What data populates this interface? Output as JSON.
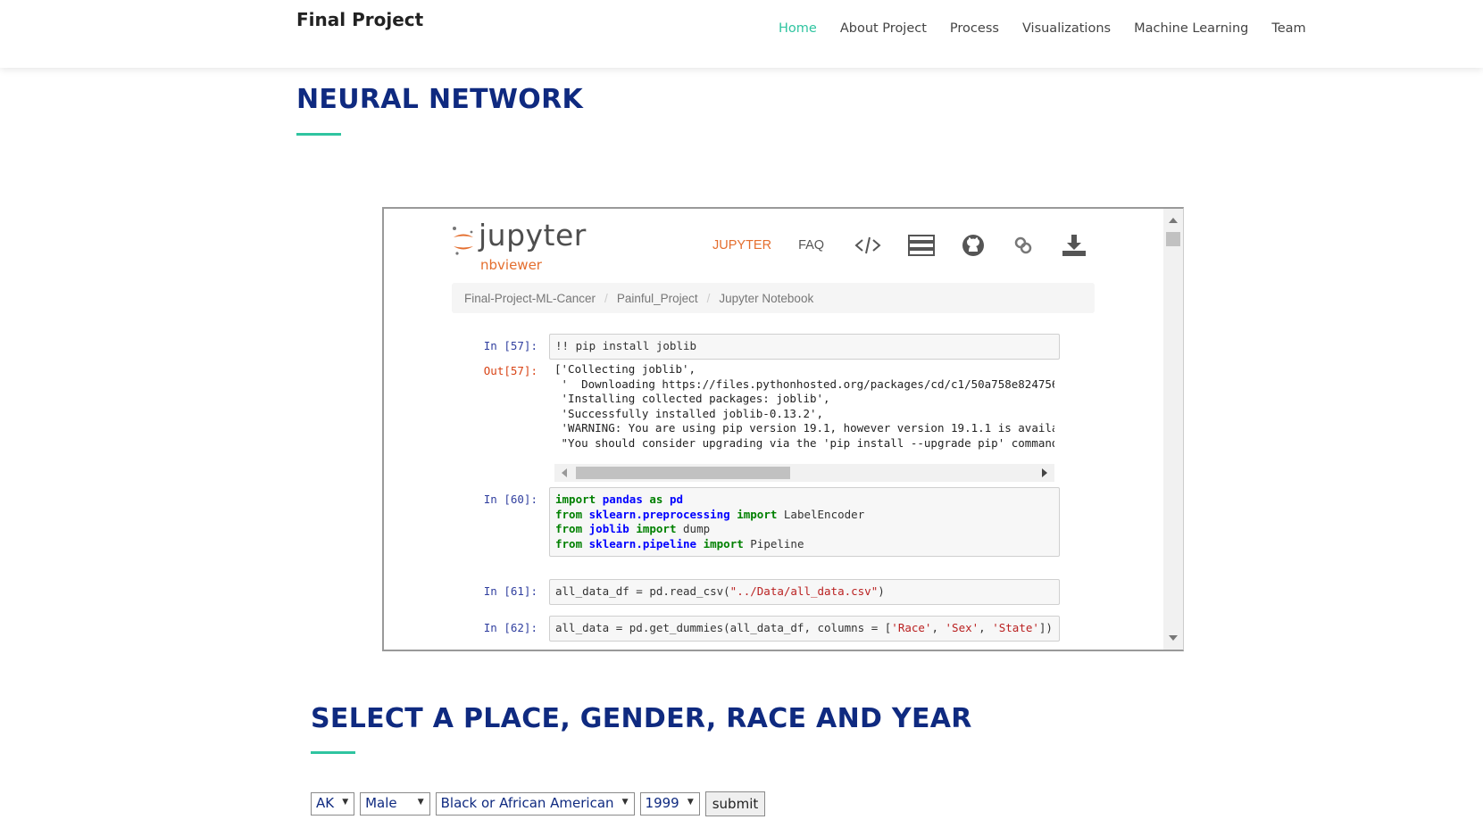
{
  "header": {
    "brand": "Final Project",
    "nav": [
      "Home",
      "About Project",
      "Process",
      "Visualizations",
      "Machine Learning",
      "Team"
    ],
    "active_index": 0
  },
  "section1": {
    "title": "NEURAL NETWORK"
  },
  "notebook": {
    "logo_word": "jupyter",
    "logo_sub": "nbviewer",
    "nav": {
      "jupyter": "JUPYTER",
      "faq": "FAQ"
    },
    "icons": [
      "code-icon",
      "server-icon",
      "github-icon",
      "link-icon",
      "download-icon"
    ],
    "breadcrumbs": [
      "Final-Project-ML-Cancer",
      "Painful_Project",
      "Jupyter Notebook"
    ],
    "cells": [
      {
        "prompt": "In [57]:",
        "code": "!! pip install joblib"
      },
      {
        "prompt": "Out[57]:",
        "output": "['Collecting joblib',\n '  Downloading https://files.pythonhosted.org/packages/cd/c1/50a758e8247561e\n 'Installing collected packages: joblib',\n 'Successfully installed joblib-0.13.2',\n 'WARNING: You are using pip version 19.1, however version 19.1.1 is availabl\n \"You should consider upgrading via the 'pip install --upgrade pip' command.\""
      },
      {
        "prompt": "In [60]:",
        "code_lines": [
          [
            "import",
            " ",
            "pandas",
            " ",
            "as",
            " ",
            "pd",
            ""
          ],
          [
            "from",
            " ",
            "sklearn.preprocessing",
            " ",
            "import",
            " ",
            "LabelEncoder",
            ""
          ],
          [
            "from",
            " ",
            "joblib",
            " ",
            "import",
            " ",
            "dump",
            ""
          ],
          [
            "from",
            " ",
            "sklearn.pipeline",
            " ",
            "import",
            " ",
            "Pipeline",
            ""
          ]
        ]
      },
      {
        "prompt": "In [61]:",
        "code_pre": "all_data_df = pd.read_csv(",
        "code_str": "\"../Data/all_data.csv\"",
        "code_post": ")"
      },
      {
        "prompt": "In [62]:",
        "code_pre": "all_data = pd.get_dummies(all_data_df, columns = [",
        "s1": "'Race'",
        "s2": "'Sex'",
        "s3": "'State'",
        "code_post": "])"
      }
    ]
  },
  "section2": {
    "title": "SELECT A PLACE, GENDER, RACE AND YEAR"
  },
  "form": {
    "state": "AK",
    "gender": "Male",
    "race": "Black or African American",
    "year": "1999",
    "submit": "submit"
  },
  "colors": {
    "accent": "#2fc4a0",
    "title": "#0f2a80",
    "jupyter_orange": "#e46e2e"
  }
}
